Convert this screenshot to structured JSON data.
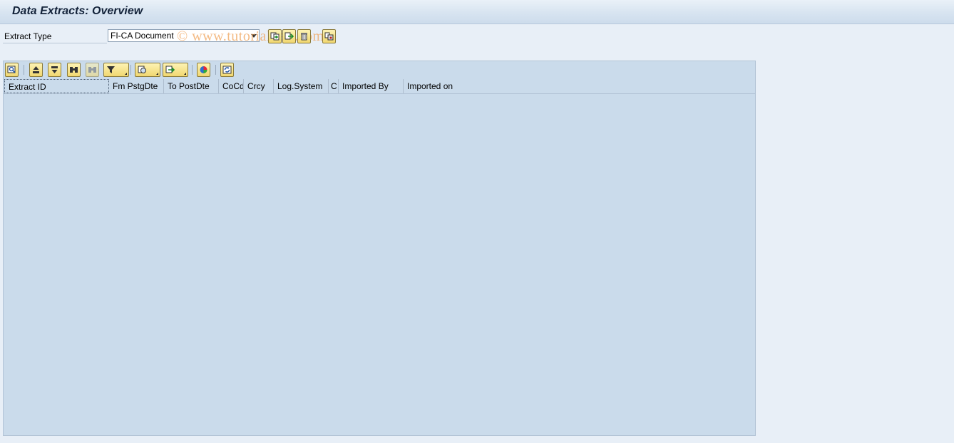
{
  "title": "Data Extracts: Overview",
  "watermark": "© www.tutorialkart.com",
  "selection": {
    "extract_type_label": "Extract Type",
    "extract_type_value": "FI-CA Document"
  },
  "top_actions": [
    {
      "icon": "copy-document-icon"
    },
    {
      "icon": "import-icon"
    },
    {
      "icon": "delete-trash-icon"
    },
    {
      "icon": "transfer-icon"
    }
  ],
  "alv_toolbar": [
    {
      "icon": "details-zoom-icon"
    },
    {
      "icon": "sort-ascending-icon"
    },
    {
      "icon": "sort-descending-icon"
    },
    {
      "icon": "find-icon"
    },
    {
      "icon": "find-next-icon"
    },
    {
      "icon": "filter-icon"
    },
    {
      "icon": "sum-icon"
    },
    {
      "icon": "export-icon"
    },
    {
      "icon": "chart-icon"
    },
    {
      "icon": "refresh-icon"
    }
  ],
  "columns": [
    "Extract ID",
    "Fm PstgDte",
    "To PostDte",
    "CoCd",
    "Crcy",
    "Log.System",
    "C",
    "Imported By",
    "Imported on"
  ],
  "rows": []
}
